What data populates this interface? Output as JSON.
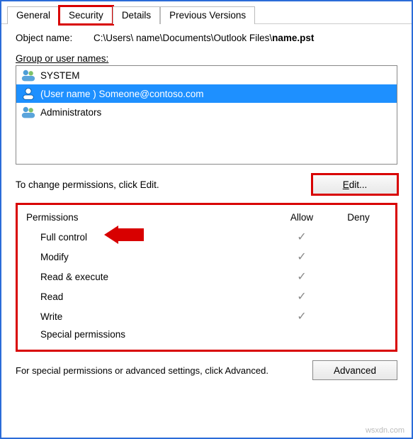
{
  "tabs": {
    "general": "General",
    "security": "Security",
    "details": "Details",
    "previous": "Previous Versions",
    "active": "security"
  },
  "object": {
    "label": "Object name:",
    "path_prefix": "C:\\Users\\ name\\Documents\\Outlook Files\\",
    "path_file": "name.pst"
  },
  "groups": {
    "label": "Group or user names:",
    "items": [
      {
        "icon": "group",
        "text": "SYSTEM",
        "selected": false
      },
      {
        "icon": "user",
        "text": "(User name ) Someone@contoso.com",
        "selected": true
      },
      {
        "icon": "group",
        "text": "Administrators",
        "selected": false
      }
    ]
  },
  "edit": {
    "text": "To change permissions, click Edit.",
    "button": "Edit..."
  },
  "permissions": {
    "headers": {
      "perm": "Permissions",
      "allow": "Allow",
      "deny": "Deny"
    },
    "rows": [
      {
        "name": "Full control",
        "allow": true,
        "deny": false,
        "arrow": true
      },
      {
        "name": "Modify",
        "allow": true,
        "deny": false
      },
      {
        "name": "Read & execute",
        "allow": true,
        "deny": false
      },
      {
        "name": "Read",
        "allow": true,
        "deny": false
      },
      {
        "name": "Write",
        "allow": true,
        "deny": false
      },
      {
        "name": "Special permissions",
        "allow": false,
        "deny": false
      }
    ]
  },
  "advanced": {
    "text": "For special permissions or advanced settings, click Advanced.",
    "button": "Advanced"
  },
  "watermark": "wsxdn.com",
  "colors": {
    "highlight": "#d80000",
    "selection": "#1e90ff",
    "border": "#2b6cd8"
  }
}
